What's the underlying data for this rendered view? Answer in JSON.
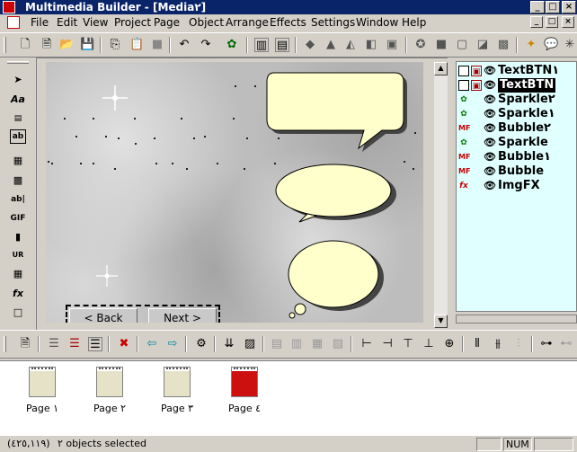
{
  "window": {
    "title": "Multimedia Builder - [Media٢]",
    "minimize_glyph": "_",
    "maximize_glyph": "□",
    "close_glyph": "×"
  },
  "menu": {
    "items": [
      "File",
      "Edit",
      "View",
      "Project",
      "Page",
      "Object",
      "Arrange",
      "Effects",
      "Settings",
      "Window",
      "Help"
    ]
  },
  "canvas": {
    "back_button": "< Back",
    "next_button": "Next >"
  },
  "objects": [
    {
      "name": "TextBTN١",
      "icon": "text-button-icon",
      "selected": false
    },
    {
      "name": "TextBTN",
      "icon": "text-button-icon",
      "selected": true
    },
    {
      "name": "Sparkle٢",
      "icon": "sparkle-icon",
      "selected": false
    },
    {
      "name": "Sparkle١",
      "icon": "sparkle-icon",
      "selected": false
    },
    {
      "name": "Bubble٢",
      "icon": "bubble-icon",
      "selected": false
    },
    {
      "name": "Sparkle",
      "icon": "sparkle-icon",
      "selected": false
    },
    {
      "name": "Bubble١",
      "icon": "bubble-icon",
      "selected": false
    },
    {
      "name": "Bubble",
      "icon": "bubble-icon",
      "selected": false
    },
    {
      "name": "ImgFX",
      "icon": "fx-icon",
      "selected": false
    }
  ],
  "pages": [
    {
      "label": "Page ١",
      "active": false
    },
    {
      "label": "Page ٢",
      "active": false
    },
    {
      "label": "Page ٣",
      "active": false
    },
    {
      "label": "Page ٤",
      "active": true
    }
  ],
  "status": {
    "coords": "(٤٢٥,١١٩)",
    "message": "٢ objects selected",
    "num": "NUM"
  },
  "colors": {
    "titlebar": "#0a246a",
    "object_list_bg": "#e0ffff",
    "active_page": "#cc1010",
    "bubble_fill": "#ffffcc"
  }
}
